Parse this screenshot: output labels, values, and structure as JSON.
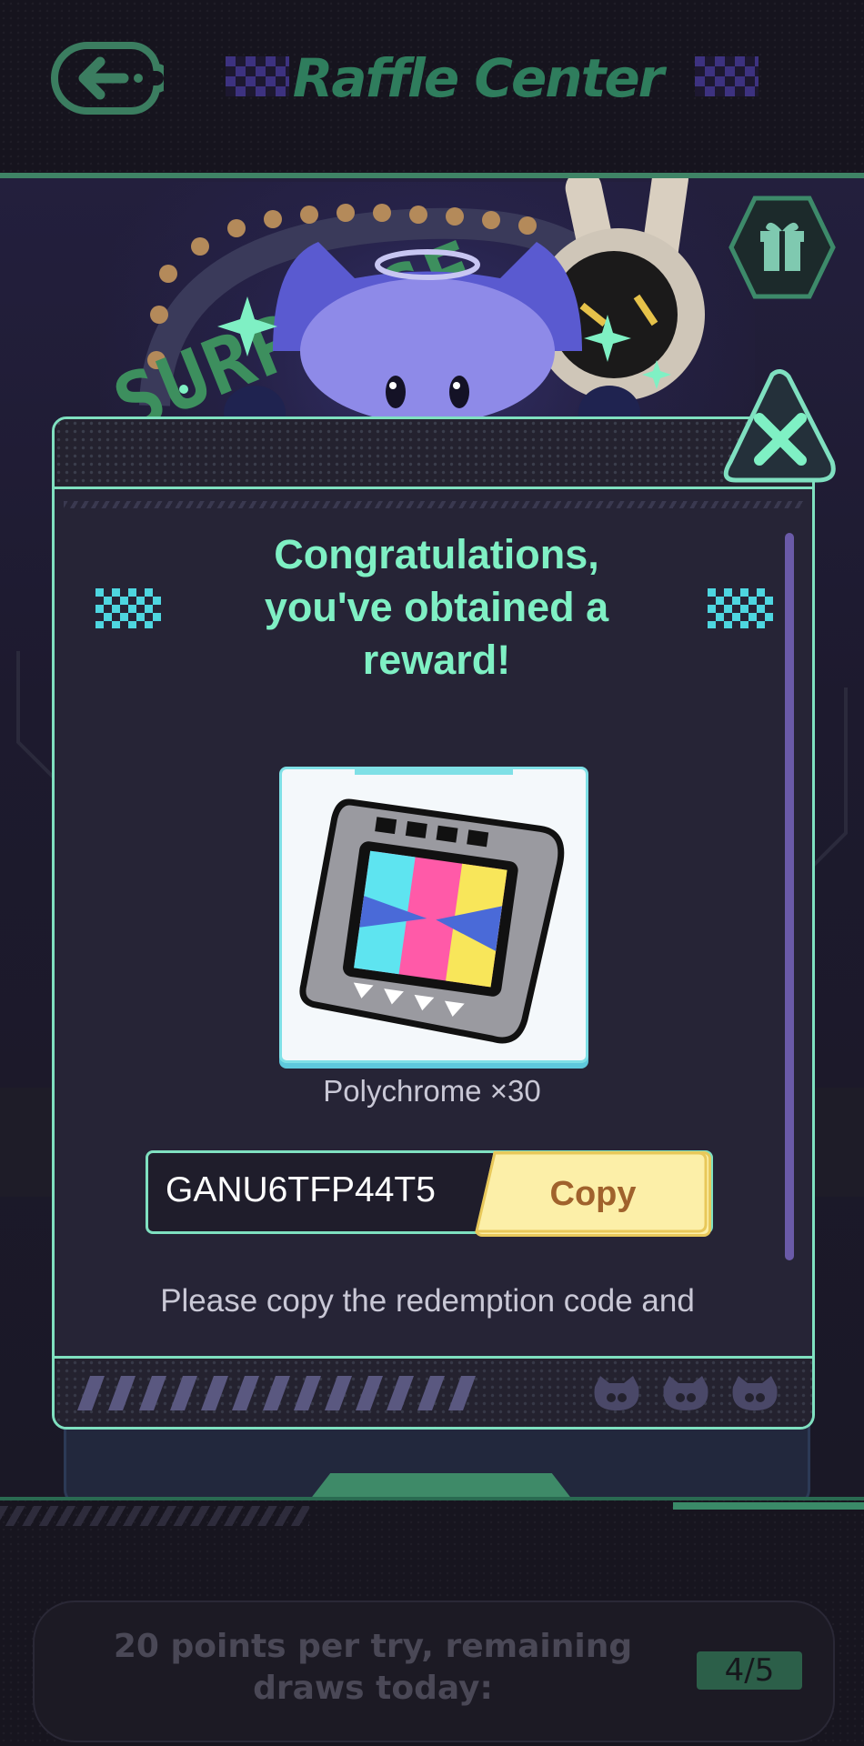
{
  "header": {
    "title": "Raffle Center",
    "back_icon": "back-arrow-icon"
  },
  "background": {
    "decor_text": "SURPRISE",
    "gift_icon": "gift-icon"
  },
  "dialog": {
    "heading": "Congratulations, you've obtained a reward!",
    "reward": {
      "icon": "film-strip-icon",
      "name": "Polychrome ×30"
    },
    "code": {
      "value": "GANU6TFP44T5",
      "copy_label": "Copy"
    },
    "hint": "Please copy the redemption code and",
    "close_icon": "close-icon"
  },
  "footer": {
    "points_text": "20 points per try, remaining draws today:",
    "draws": "4/5"
  },
  "colors": {
    "accent_green": "#7ff0c4",
    "border_mint": "#7fe0c0",
    "copy_yellow": "#fcefa8",
    "title_green": "#2f7d5d"
  }
}
